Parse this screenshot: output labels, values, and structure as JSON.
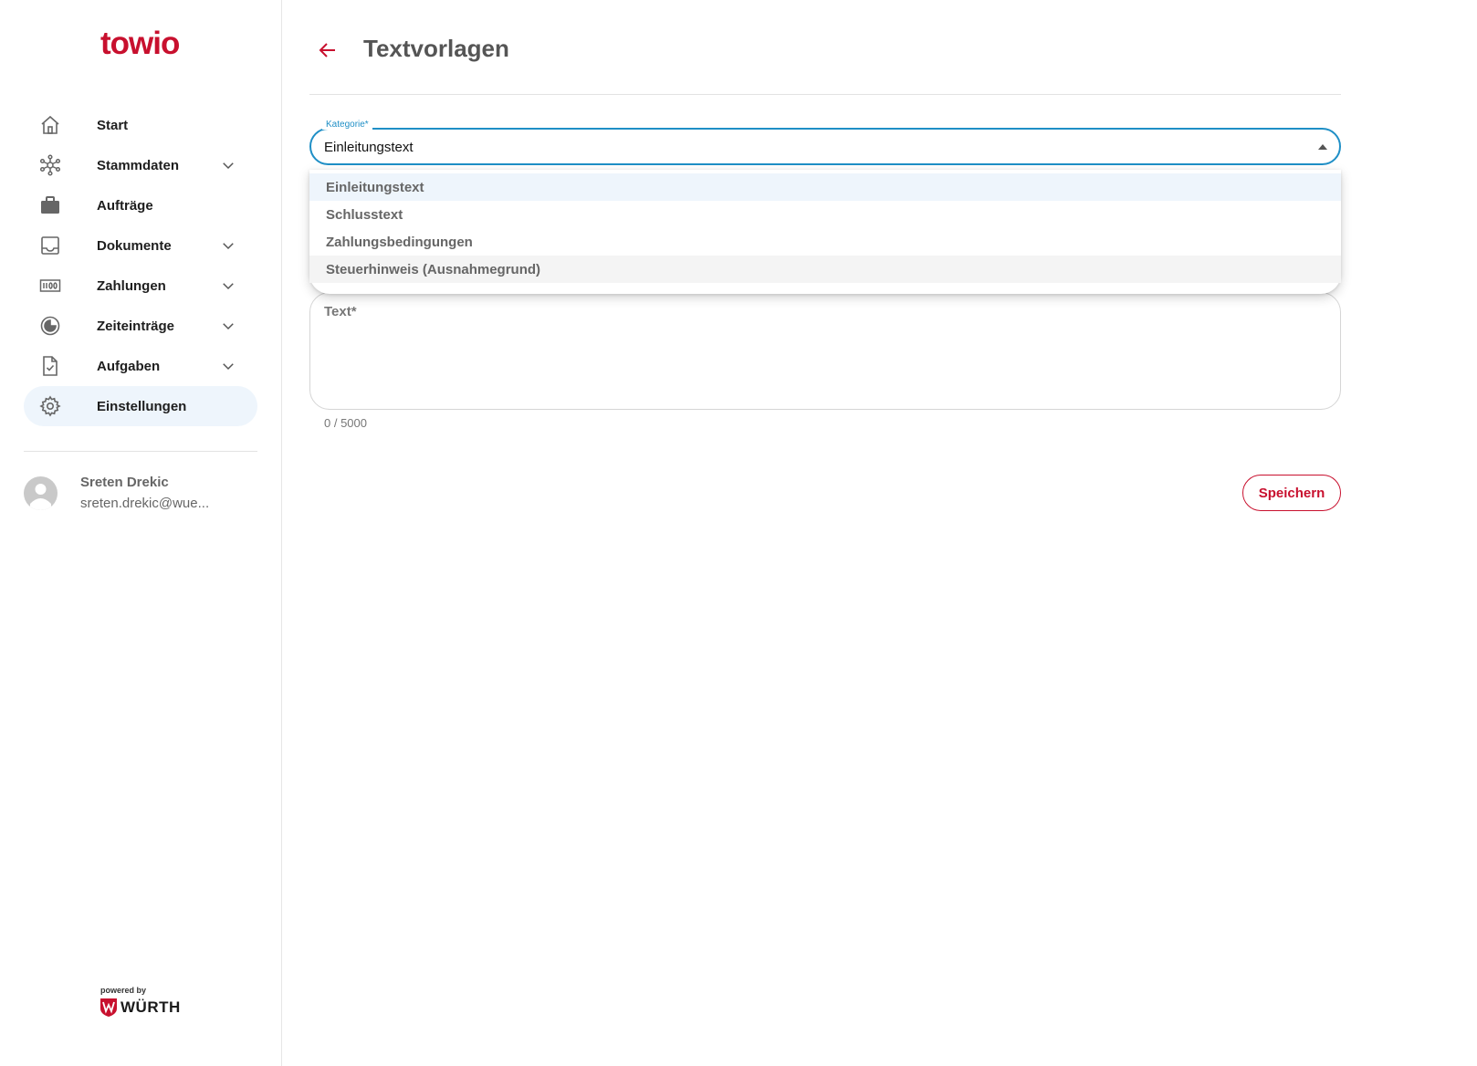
{
  "brand": {
    "logo_text": "towio",
    "powered_by": "powered by",
    "partner_name": "WÜRTH",
    "accent": "#c8102e"
  },
  "sidebar": {
    "items": [
      {
        "label": "Start",
        "icon": "home-icon",
        "has_children": false,
        "active": false
      },
      {
        "label": "Stammdaten",
        "icon": "network-icon",
        "has_children": true,
        "active": false
      },
      {
        "label": "Aufträge",
        "icon": "briefcase-icon",
        "has_children": false,
        "active": false
      },
      {
        "label": "Dokumente",
        "icon": "inbox-icon",
        "has_children": true,
        "active": false
      },
      {
        "label": "Zahlungen",
        "icon": "money-icon",
        "has_children": true,
        "active": false
      },
      {
        "label": "Zeiteinträge",
        "icon": "clock-icon",
        "has_children": true,
        "active": false
      },
      {
        "label": "Aufgaben",
        "icon": "task-document-icon",
        "has_children": true,
        "active": false
      },
      {
        "label": "Einstellungen",
        "icon": "gear-icon",
        "has_children": false,
        "active": true
      }
    ]
  },
  "user": {
    "name": "Sreten Drekic",
    "email": "sreten.drekic@wue..."
  },
  "header": {
    "title": "Textvorlagen"
  },
  "form": {
    "category": {
      "label": "Kategorie*",
      "value": "Einleitungstext",
      "options": [
        "Einleitungstext",
        "Schlusstext",
        "Zahlungsbedingungen",
        "Steuerhinweis (Ausnahmegrund)"
      ]
    },
    "text": {
      "label": "Text*",
      "counter": "0 / 5000"
    },
    "save_label": "Speichern"
  }
}
